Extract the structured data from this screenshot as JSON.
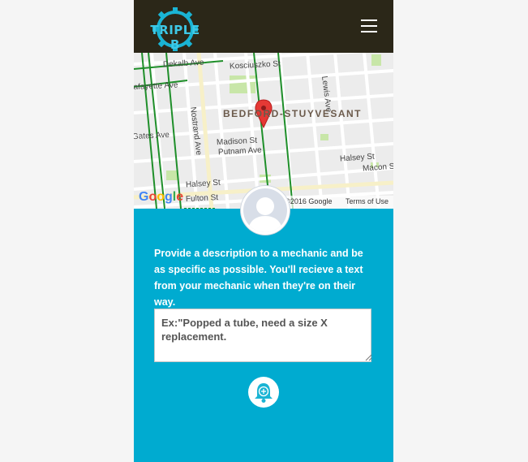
{
  "brand": {
    "logo_text": "TRIPLE B"
  },
  "map": {
    "neighborhood": "BEDFORD-STUYVESANT",
    "streets": [
      "Dekalb Ave",
      "Kosciuszko St",
      "Lafayette Ave",
      "Lewis Ave",
      "Nostrand Ave",
      "Madison St",
      "Putnam Ave",
      "Halsey St",
      "Halsey St",
      "Macon St",
      "Gates Ave",
      "Fulton St"
    ],
    "google": "Google",
    "copyright": "©2016 Google",
    "terms": "Terms of Use"
  },
  "form": {
    "description": "Provide a description to a mechanic and be as specific as possible. You'll recieve a text from your mechanic when they're on their way.",
    "placeholder": "Ex:\"Popped a tube, need a size X replacement."
  },
  "colors": {
    "navbar": "#2b2718",
    "panel": "#00abd0",
    "accent": "#1ab4d4",
    "pin": "#e53935"
  },
  "icons": {
    "menu": "hamburger-icon",
    "avatar": "user-silhouette-icon",
    "submit": "bell-plus-icon",
    "pin": "map-pin-icon"
  }
}
